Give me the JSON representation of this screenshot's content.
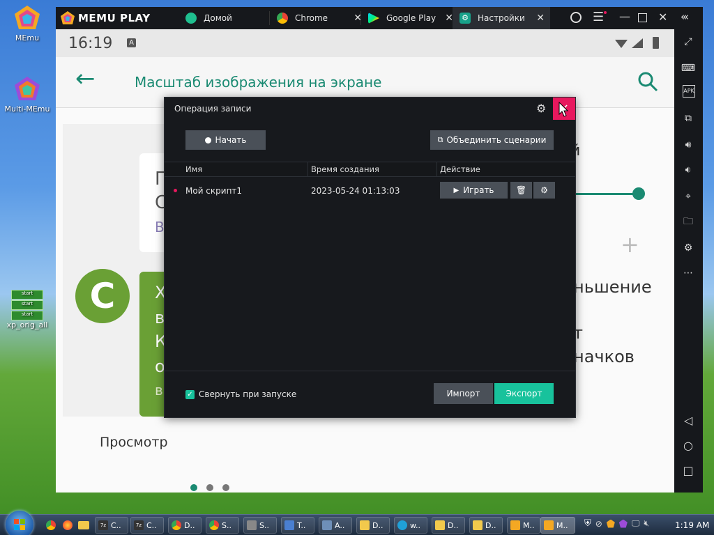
{
  "desktop": {
    "icons": [
      {
        "label": "MEmu"
      },
      {
        "label": "Multi-MEmu"
      },
      {
        "label": "xp_orig_all",
        "badges": [
          "start",
          "start",
          "start"
        ]
      }
    ]
  },
  "emulator": {
    "brand": "MEMU PLAY",
    "tabs": [
      {
        "label": "Домой",
        "icon": "home-app-icon",
        "color": "#1fbf8f"
      },
      {
        "label": "Chrome",
        "icon": "chrome-icon"
      },
      {
        "label": "Google Play",
        "icon": "google-play-icon"
      },
      {
        "label": "Настройки",
        "icon": "settings-app-icon",
        "color": "#18a28a"
      }
    ],
    "sidebar_icons": [
      "fullscreen-icon",
      "keyboard-icon",
      "apk-icon",
      "add-window-icon",
      "volume-up-icon",
      "volume-down-icon",
      "location-icon",
      "folder-icon",
      "settings-icon",
      "more-icon",
      "back-nav-icon",
      "home-nav-icon",
      "recents-nav-icon"
    ]
  },
  "android": {
    "time": "16:19",
    "status_badge": "A",
    "page_title": "Масштаб изображения на экране",
    "preview_label": "Просмотр",
    "card_letters": [
      "П",
      "С",
      "В"
    ],
    "bubble_letter": "C",
    "bubble_letters": [
      "Х",
      "в",
      "К",
      "о",
      "в"
    ],
    "right_texts": [
      "й",
      "ньшение",
      "т",
      "начков"
    ],
    "plus": "+",
    "page_dots": 3,
    "accent_color": "#1a8a72"
  },
  "dialog": {
    "title": "Операция записи",
    "start_button": "Начать",
    "merge_button": "Объединить сценарии",
    "columns": [
      "Имя",
      "Время создания",
      "Действие"
    ],
    "rows": [
      {
        "name": "Мой скрипт1",
        "created": "2023-05-24 01:13:03",
        "play": "Играть"
      }
    ],
    "collapse_label": "Свернуть при запуске",
    "collapse_checked": true,
    "import_button": "Импорт",
    "export_button": "Экспорт",
    "accent_color": "#18c29c",
    "close_color": "#e8185e"
  },
  "taskbar": {
    "items": [
      {
        "label": "C..",
        "icon": "7zip-icon"
      },
      {
        "label": "C..",
        "icon": "7zip-icon"
      },
      {
        "label": "D..",
        "icon": "chrome-icon"
      },
      {
        "label": "S..",
        "icon": "chrome-icon"
      },
      {
        "label": "S..",
        "icon": "gear-icon"
      },
      {
        "label": "T..",
        "icon": "app-icon"
      },
      {
        "label": "A..",
        "icon": "document-icon"
      },
      {
        "label": "D..",
        "icon": "folder-icon"
      },
      {
        "label": "w..",
        "icon": "edge-icon"
      },
      {
        "label": "D..",
        "icon": "folder-icon"
      },
      {
        "label": "D..",
        "icon": "folder-icon"
      },
      {
        "label": "M..",
        "icon": "memu-icon"
      },
      {
        "label": "M..",
        "icon": "memu-icon"
      }
    ],
    "clock": "1:19 AM"
  }
}
